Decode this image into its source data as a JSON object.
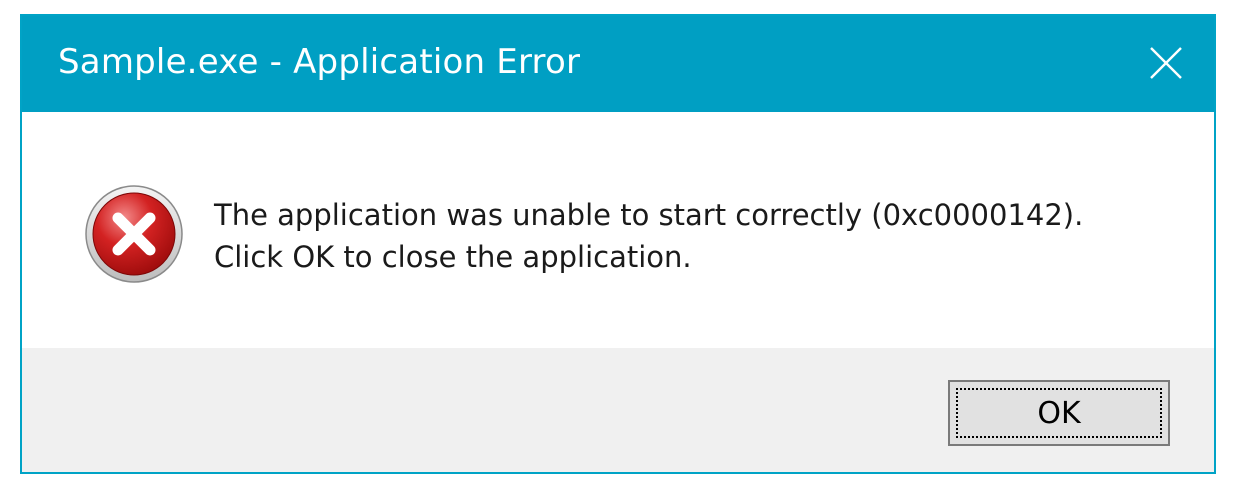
{
  "window": {
    "title": "Sample.exe - Application Error",
    "close_icon": "close-icon",
    "titlebar_color": "#009fc3"
  },
  "content": {
    "icon": "error-icon",
    "message_lines": [
      "The application was unable to start correctly (0xc0000142).",
      "Click OK to close the application."
    ]
  },
  "footer": {
    "ok_label": "OK"
  }
}
